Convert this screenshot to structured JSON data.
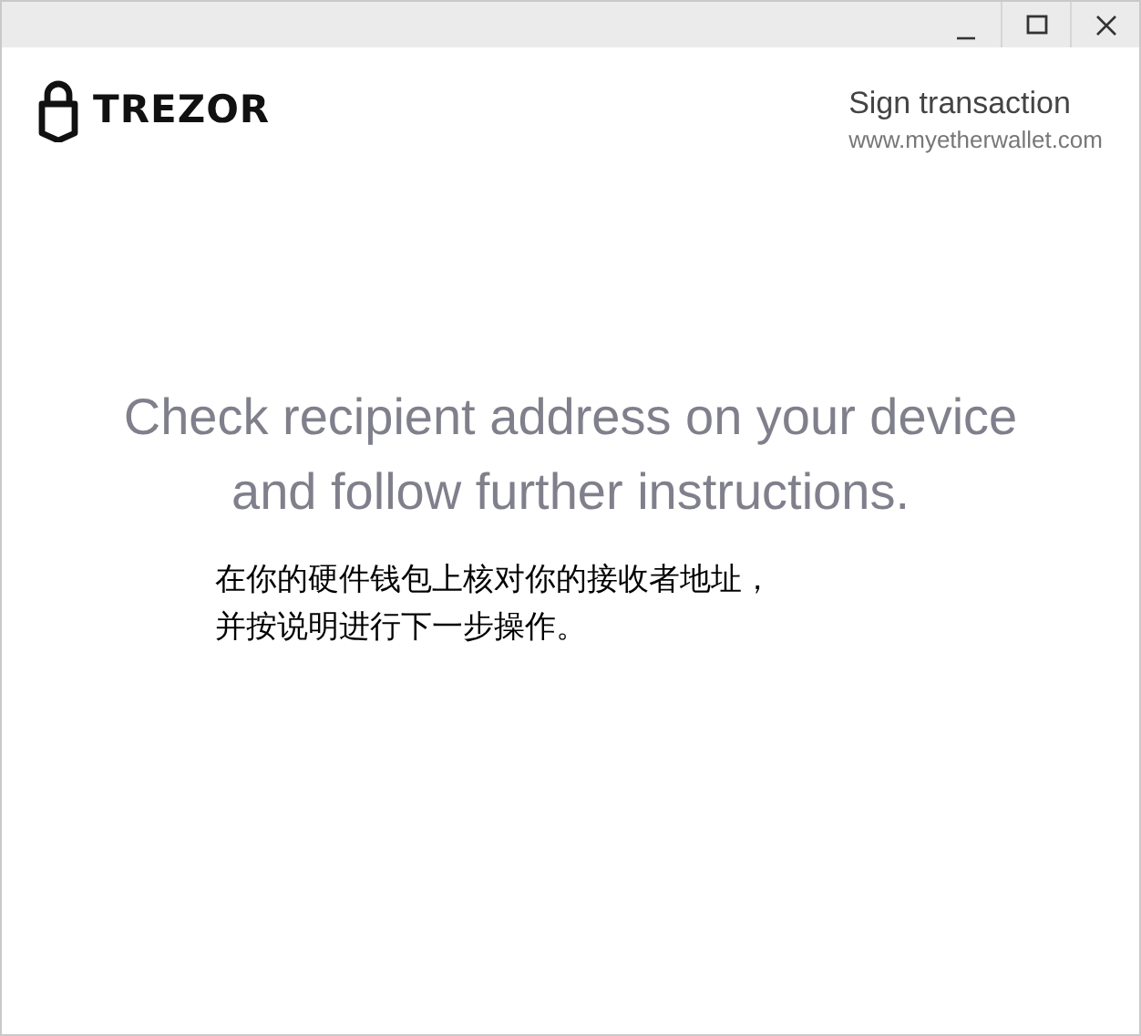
{
  "window": {
    "controls": [
      {
        "kind": "minimize"
      },
      {
        "kind": "maximize"
      },
      {
        "kind": "close"
      }
    ]
  },
  "header": {
    "brand": "TREZOR",
    "title": "Sign transaction",
    "origin": "www.myetherwallet.com"
  },
  "message": "Check recipient address on your device and follow further instructions.",
  "annotation": [
    "在你的硬件钱包上核对你的接收者地址，",
    "并按说明进行下一步操作。"
  ]
}
